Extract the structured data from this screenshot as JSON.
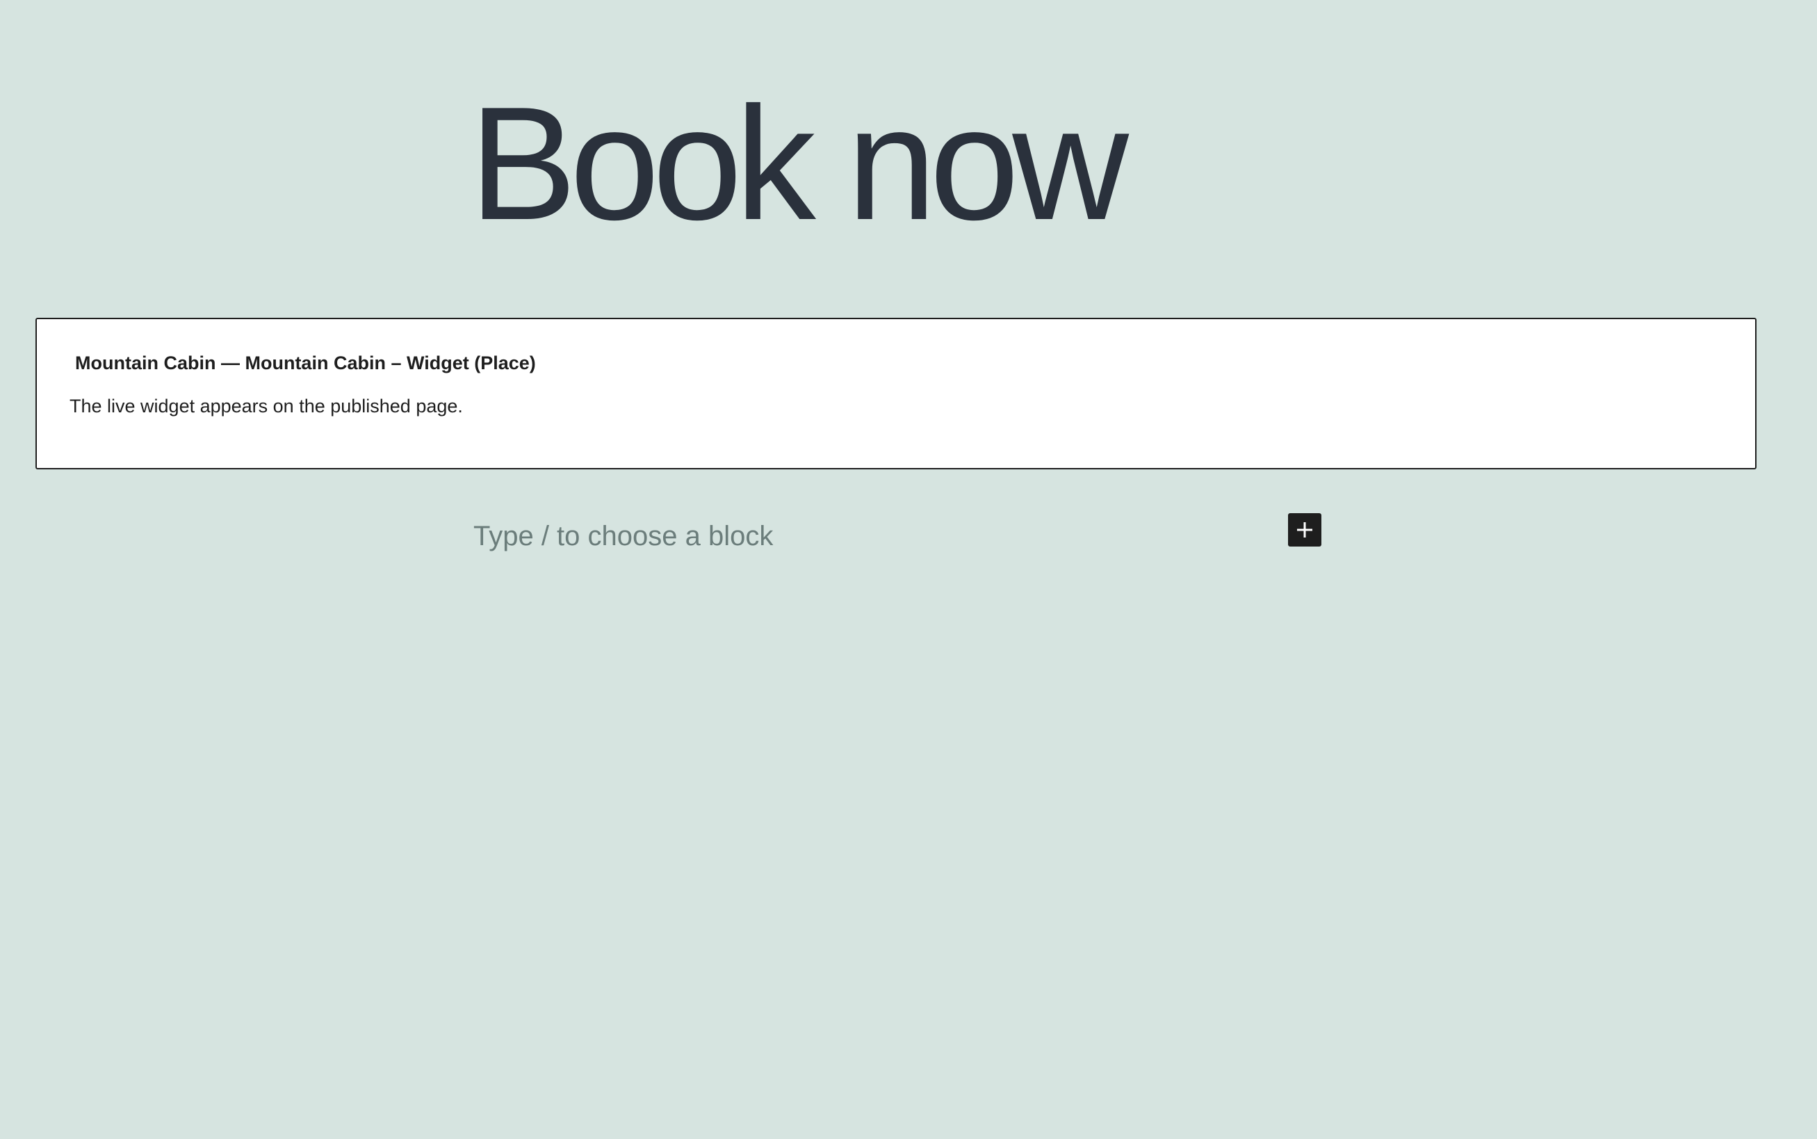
{
  "page": {
    "title": "Book now"
  },
  "widget": {
    "heading": "Mountain Cabin — Mountain Cabin – Widget (Place)",
    "note": "The live widget appears on the published page."
  },
  "editor": {
    "placeholder": "Type / to choose a block",
    "inserter_icon": "plus-icon"
  },
  "colors": {
    "background": "#d6e4e0",
    "title": "#2a313c",
    "placeholder": "#6b7d7b",
    "inserter": "#1e1e1e"
  }
}
